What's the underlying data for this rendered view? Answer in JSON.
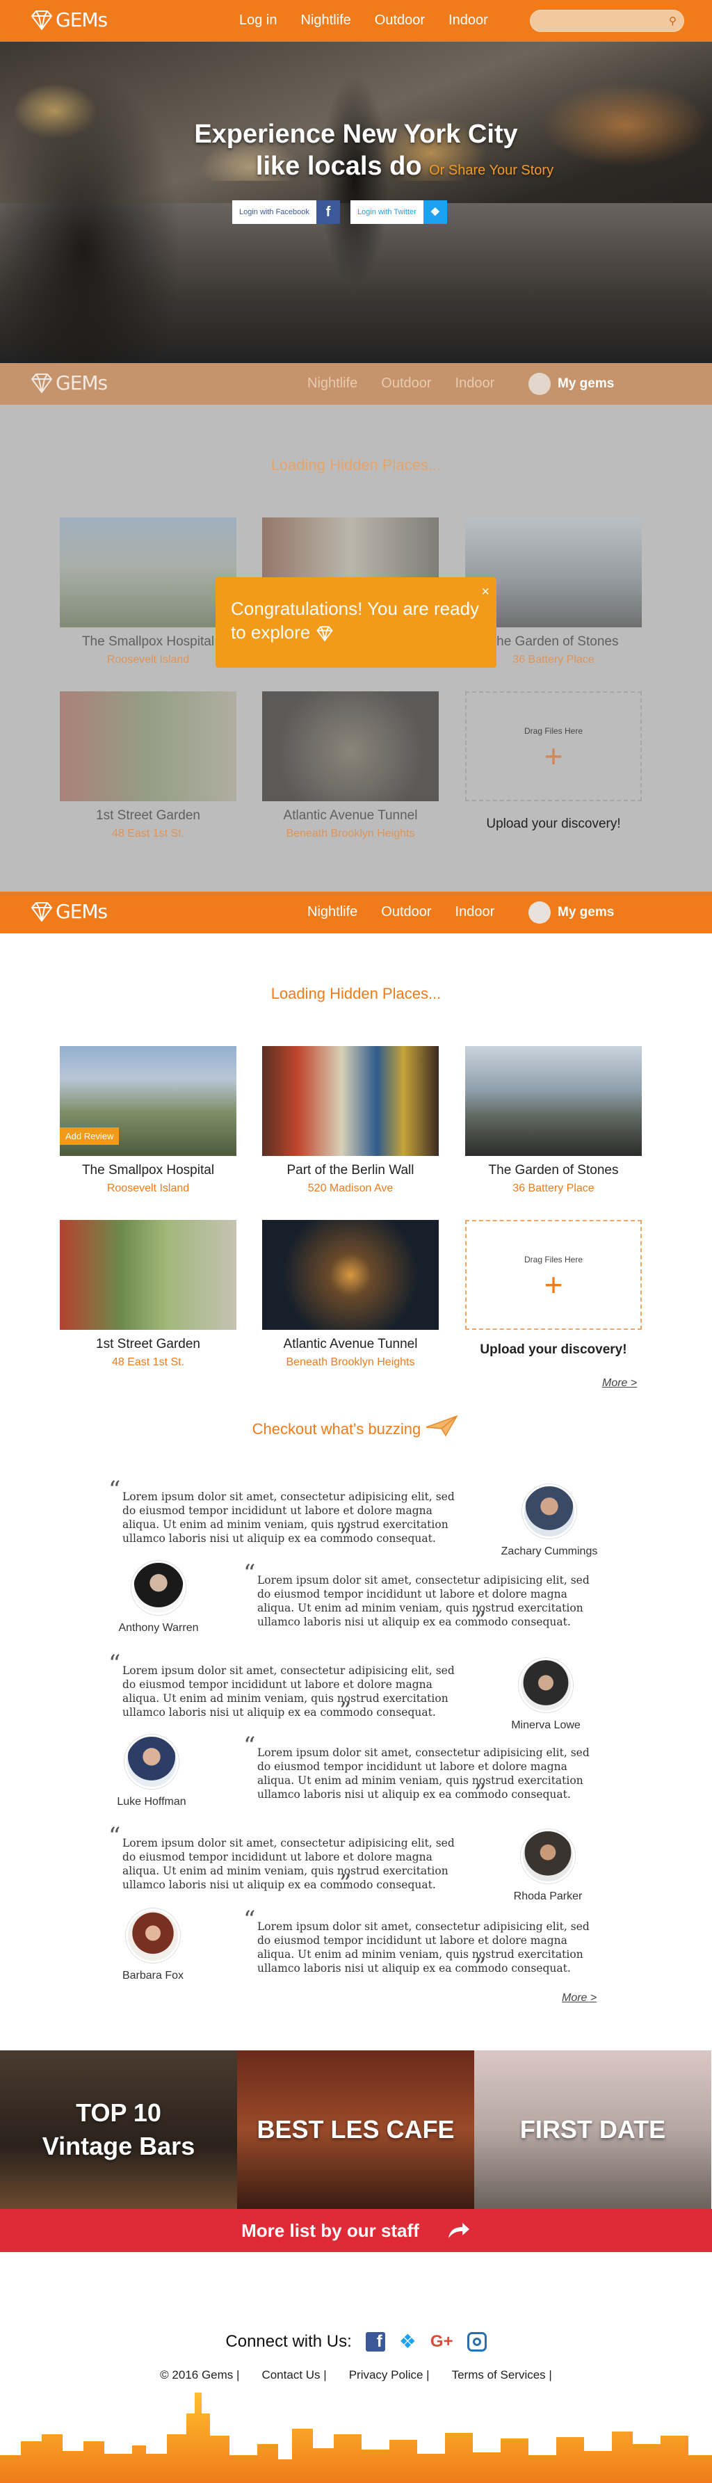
{
  "brand": {
    "name": "GEMs",
    "accent": "#f07b1a",
    "red": "#e02a38"
  },
  "top_nav": {
    "login": "Log in",
    "items": [
      "Nightlife",
      "Outdoor",
      "Indoor"
    ],
    "search_icon": "search-icon"
  },
  "hero": {
    "line1": "Experience New York City",
    "line2": "like locals do",
    "share": "Or Share Your Story",
    "facebook_btn": "Login with Facebook",
    "twitter_btn": "Login with Twitter"
  },
  "nav2": {
    "items": [
      "Nightlife",
      "Outdoor",
      "Indoor"
    ],
    "my_gems": "My gems"
  },
  "loading": "Loading Hidden Places...",
  "toast": {
    "text": "Congratulations! You are ready to explore",
    "close": "×"
  },
  "places": [
    {
      "name": "The Smallpox Hospital",
      "sub": "Roosevelt Island"
    },
    {
      "name": "Part of the Berlin Wall",
      "sub": "520 Madison Ave"
    },
    {
      "name": "The Garden of Stones",
      "sub": "36 Battery Place"
    },
    {
      "name": "1st Street Garden",
      "sub": "48 East 1st St."
    },
    {
      "name": "Atlantic Avenue Tunnel",
      "sub": "Beneath Brooklyn Heights"
    }
  ],
  "upload": {
    "drag": "Drag Files Here",
    "plus": "+",
    "label": "Upload your discovery!"
  },
  "add_review": "Add Review",
  "more": "More >",
  "buzz": {
    "title": "Checkout what's buzzing",
    "quote": "Lorem ipsum dolor sit amet, consectetur adipisicing elit, sed do eiusmod tempor incididunt ut labore et dolore magna aliqua. Ut enim ad minim veniam, quis nostrud exercitation ullamco laboris nisi ut aliquip ex ea commodo consequat.",
    "people": [
      "Zachary Cummings",
      "Anthony Warren",
      "Minerva Lowe",
      "Luke Hoffman",
      "Rhoda Parker",
      "Barbara Fox"
    ]
  },
  "lists": [
    "TOP 10 Vintage Bars",
    "BEST LES CAFE",
    "FIRST DATE"
  ],
  "lists_top": [
    "TOP 10",
    "Vintage Bars"
  ],
  "staff": "More list by our staff",
  "footer": {
    "connect": "Connect with Us:",
    "copy": "© 2016 Gems |",
    "contact": "Contact Us |",
    "privacy": "Privacy Police |",
    "terms": "Terms of Services |"
  }
}
